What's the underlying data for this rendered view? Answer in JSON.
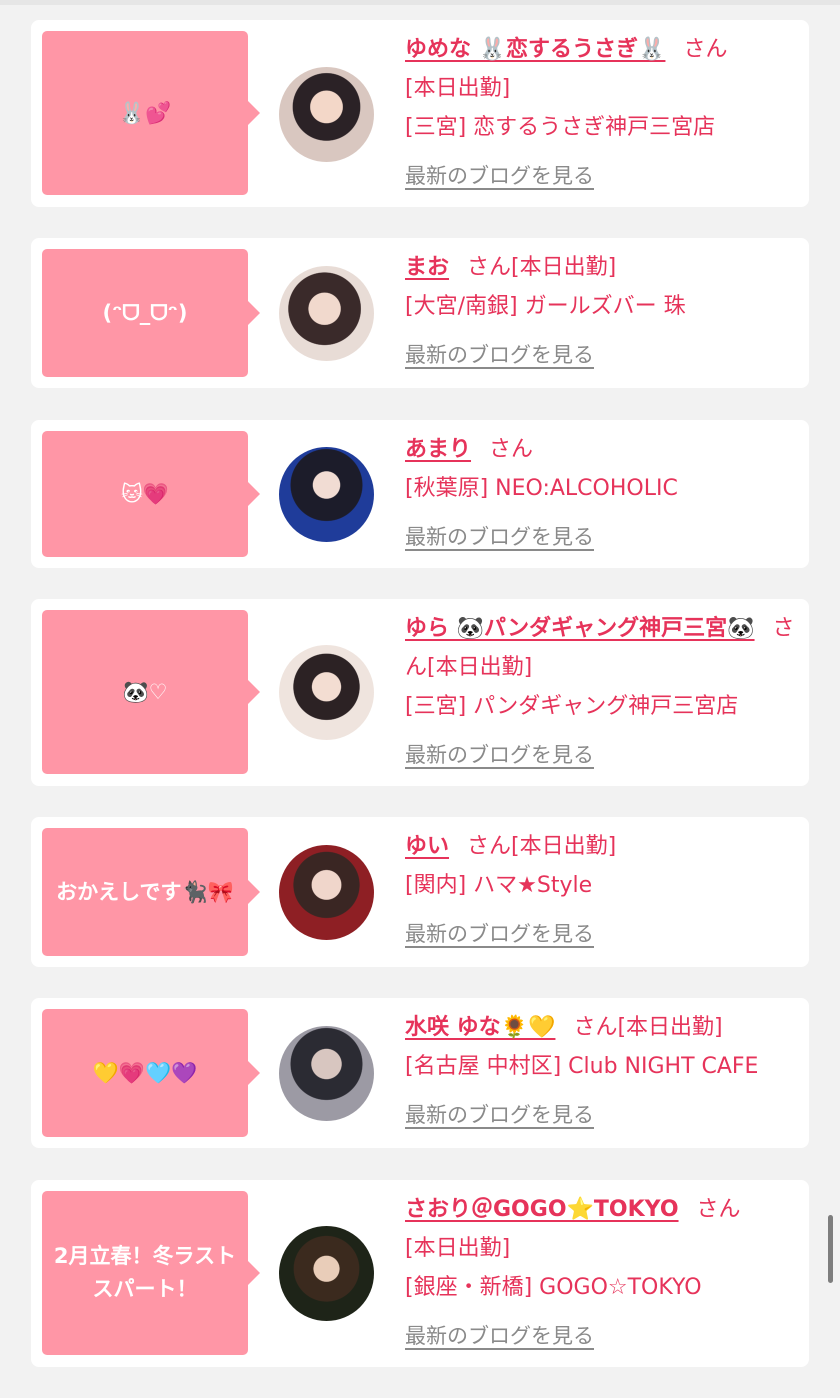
{
  "colors": {
    "accent": "#e6335a",
    "bubble": "#ff96a6",
    "card": "#ffffff",
    "page": "#f2f2f2",
    "link_gray": "#8a8a8a"
  },
  "cards": [
    {
      "bubble": "🐰💕",
      "name": "ゆめな 🐰恋するうさぎ🐰",
      "suffix": "さん",
      "status": "[本日出勤]",
      "location": "[三宮] 恋するうさぎ神戸三宮店",
      "blog_link": "最新のブログを見る"
    },
    {
      "bubble": "(ᵔᗜ_ᗜᵔ)",
      "name": "まお",
      "suffix": "さん[本日出勤]",
      "status": "",
      "location": "[大宮/南銀] ガールズバー 珠",
      "blog_link": "最新のブログを見る"
    },
    {
      "bubble": "🐱💗",
      "name": "あまり",
      "suffix": "さん",
      "status": "",
      "location": "[秋葉原] NEO:ALCOHOLIC",
      "blog_link": "最新のブログを見る"
    },
    {
      "bubble": "🐼♡",
      "name": "ゆら 🐼パンダギャング神戸三宮🐼",
      "suffix": "さん[本日出勤]",
      "status": "",
      "location": "[三宮] パンダギャング神戸三宮店",
      "blog_link": "最新のブログを見る"
    },
    {
      "bubble": "おかえしです🐈‍⬛🎀",
      "name": "ゆい",
      "suffix": "さん[本日出勤]",
      "status": "",
      "location": "[関内] ハマ★Style",
      "blog_link": "最新のブログを見る"
    },
    {
      "bubble": "💛💗🩵💜",
      "name": "水咲 ゆな🌻💛",
      "suffix": "さん[本日出勤]",
      "status": "",
      "location": "[名古屋 中村区] Club NIGHT CAFE",
      "blog_link": "最新のブログを見る"
    },
    {
      "bubble": "2月立春！冬ラストスパート！",
      "name": "さおり＠GOGO⭐TOKYO",
      "suffix": "さん",
      "status": "[本日出勤]",
      "location": "[銀座・新橋] GOGO☆TOKYO",
      "blog_link": "最新のブログを見る"
    }
  ]
}
